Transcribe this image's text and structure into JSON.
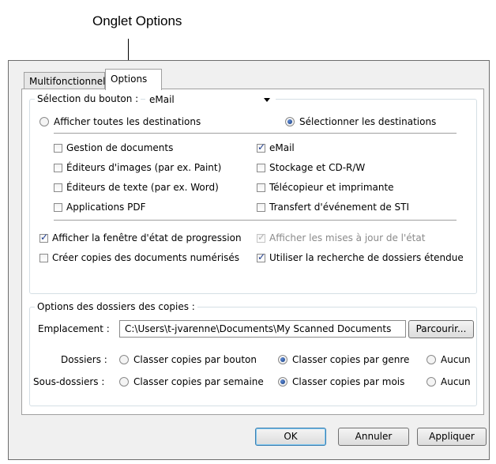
{
  "callout": {
    "label": "Onglet Options"
  },
  "tabs": [
    {
      "label": "Multifonctionnel",
      "active": false
    },
    {
      "label": "Options",
      "active": true
    }
  ],
  "button_selection": {
    "label": "Sélection du bouton :",
    "value": "eMail"
  },
  "destinations": {
    "show_all_label": "Afficher toutes les destinations",
    "select_label": "Sélectionner les destinations",
    "selected_mode": "select",
    "items": [
      {
        "label": "Gestion de documents",
        "checked": false
      },
      {
        "label": "Éditeurs d'images (par ex. Paint)",
        "checked": false
      },
      {
        "label": "Éditeurs de texte (par ex. Word)",
        "checked": false
      },
      {
        "label": "Applications PDF",
        "checked": false
      },
      {
        "label": "eMail",
        "checked": true
      },
      {
        "label": "Stockage et CD-R/W",
        "checked": false
      },
      {
        "label": "Télécopieur et imprimante",
        "checked": false
      },
      {
        "label": "Transfert d'événement de STI",
        "checked": false
      }
    ]
  },
  "options": [
    {
      "label": "Afficher la fenêtre d'état de progression",
      "checked": true,
      "enabled": true
    },
    {
      "label": "Afficher les mises à jour de l'état",
      "checked": true,
      "enabled": false
    },
    {
      "label": "Créer copies des documents numérisés",
      "checked": false,
      "enabled": true
    },
    {
      "label": "Utiliser la recherche de dossiers étendue",
      "checked": true,
      "enabled": true
    }
  ],
  "copies": {
    "legend": "Options des dossiers des copies :",
    "location_label": "Emplacement :",
    "location_value": "C:\\Users\\t-jvarenne\\Documents\\My Scanned Documents",
    "browse_label": "Parcourir...",
    "folders_label": "Dossiers :",
    "folders_options": [
      "Classer copies par bouton",
      "Classer copies par genre",
      "Aucun"
    ],
    "folders_selected": 1,
    "subfolders_label": "Sous-dossiers :",
    "subfolders_options": [
      "Classer copies par semaine",
      "Classer copies par mois",
      "Aucun"
    ],
    "subfolders_selected": 1
  },
  "footer": {
    "ok_label": "OK",
    "cancel_label": "Annuler",
    "apply_label": "Appliquer"
  }
}
